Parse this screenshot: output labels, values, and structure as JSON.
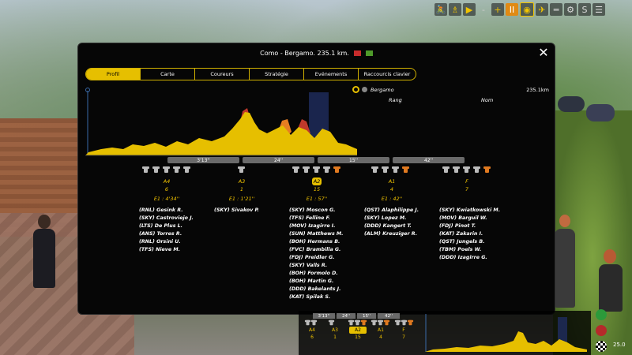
{
  "toolbar": {
    "icons": [
      "cyclist-icon",
      "trophy-icon",
      "play-icon",
      "separator",
      "plus-icon",
      "pause-icon",
      "eye-icon",
      "car-icon",
      "gun-icon",
      "settings-icon",
      "money-icon",
      "menu-icon"
    ],
    "pause_label": "II"
  },
  "modal": {
    "title": "Como - Bergamo. 235.1 km.",
    "tabs": [
      "Profil",
      "Carte",
      "Coureurs",
      "Stratégie",
      "Evénements",
      "Raccourcis clavier"
    ],
    "active_tab": "Profil",
    "finish": {
      "city": "Bergamo",
      "distance": "235.1km"
    },
    "columns": {
      "rank": "Rang",
      "name": "Nom"
    },
    "gaps": [
      "3'13''",
      "24''",
      "15''",
      "42''"
    ],
    "groups": [
      {
        "code": "A4",
        "count": "6",
        "gap": "E1 : 4'34''",
        "riders": [
          "(RNL) Gesink R.",
          "(SKY) Castroviejo J.",
          "(LTS) De Plus L.",
          "(ANS) Torres R.",
          "(RNL) Orsini U.",
          "(TFS) Nieve M."
        ]
      },
      {
        "code": "A3",
        "count": "1",
        "gap": "E1 : 1'21''",
        "riders": [
          "(SKY) Sivakov P."
        ]
      },
      {
        "code": "A2",
        "count": "15",
        "gap": "E1 : 57''",
        "riders": [
          "(SKY) Moscon G.",
          "(TFS) Felline F.",
          "(MOV) Izagirre I.",
          "(SUN) Matthews M.",
          "(BOH) Hermans B.",
          "(FVC) Brambilla G.",
          "(FDJ) Preidler G.",
          "(SKY) Valls R.",
          "(BOH) Formolo D.",
          "(BOH) Martin G.",
          "(DDD) Bakelants J.",
          "(KAT) Spilak S."
        ]
      },
      {
        "code": "A1",
        "count": "4",
        "gap": "E1 : 42''",
        "riders": [
          "(QST) Alaphilippe J.",
          "(SKY) Lopez M.",
          "(DDD) Kangert T.",
          "(ALM) Kreuziger R."
        ]
      },
      {
        "code": "F",
        "count": "7",
        "gap": "",
        "riders": [
          "(SKY) Kwiatkowski M.",
          "(MOV) Barguil W.",
          "(FDJ) Pinot T.",
          "(KAT) Zakarin I.",
          "(QST) Jungels B.",
          "(TBM) Poels W.",
          "(DDD) Izagirre G."
        ]
      }
    ]
  },
  "minimap": {
    "gaps": [
      "3'13''",
      "24''",
      "15''",
      "42''"
    ],
    "groups": [
      {
        "code": "A4",
        "count": "6"
      },
      {
        "code": "A3",
        "count": "1"
      },
      {
        "code": "A2",
        "count": "15"
      },
      {
        "code": "A1",
        "count": "4"
      },
      {
        "code": "F",
        "count": "7"
      }
    ],
    "speed": "25.0"
  },
  "colors": {
    "accent": "#e6bf00",
    "jersey_grey": "#bbbbbb",
    "jersey_orange": "#e07a20"
  }
}
